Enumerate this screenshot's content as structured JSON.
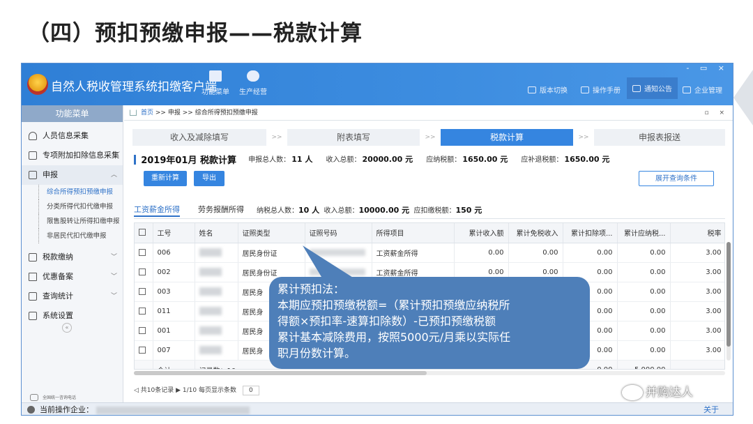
{
  "slide": {
    "title": "（四）预扣预缴申报——税款计算"
  },
  "app": {
    "name": "自然人税收管理系统扣缴客户端",
    "tools": [
      {
        "label": "功能菜单",
        "icon": "menu-icon"
      },
      {
        "label": "生产经营",
        "icon": "database-icon"
      }
    ],
    "right_tools": [
      {
        "label": "版本切换",
        "icon": "version-icon"
      },
      {
        "label": "操作手册",
        "icon": "manual-icon"
      },
      {
        "label": "通知公告",
        "icon": "mail-icon"
      },
      {
        "label": "企业管理",
        "icon": "building-icon"
      }
    ],
    "window_controls": "- ▭ ×"
  },
  "sidebar": {
    "header": "功能菜单",
    "items": [
      {
        "label": "人员信息采集",
        "icon": "person-icon"
      },
      {
        "label": "专项附加扣除信息采集",
        "icon": "list-icon",
        "chevron": "﹀"
      },
      {
        "label": "申报",
        "icon": "grid-icon",
        "chevron": "︿"
      }
    ],
    "subitems": [
      {
        "label": "综合所得预扣预缴申报"
      },
      {
        "label": "分类所得代扣代缴申报"
      },
      {
        "label": "限售股转让所得扣缴申报"
      },
      {
        "label": "非居民代扣代缴申报"
      }
    ],
    "items2": [
      {
        "label": "税款缴纳",
        "icon": "grid-icon",
        "chevron": "﹀"
      },
      {
        "label": "优惠备案",
        "icon": "doc-icon",
        "chevron": "﹀"
      },
      {
        "label": "查询统计",
        "icon": "grid-icon",
        "chevron": "﹀"
      },
      {
        "label": "系统设置",
        "icon": "grid-icon",
        "chevron": ""
      }
    ],
    "collapse": "«",
    "hotline_label": "全国统一咨询电话",
    "hotline_1": "12366",
    "hotline_2": "4001007815"
  },
  "status": {
    "label": "当前操作企业：",
    "link": "关于"
  },
  "breadcrumb": {
    "home": "首页",
    "sep": ">>",
    "level1": "申报",
    "level2": "综合所得预扣预缴申报",
    "controls": "▫ ×"
  },
  "steps": [
    {
      "label": "收入及减除填写"
    },
    {
      "label": "附表填写"
    },
    {
      "label": "税款计算"
    },
    {
      "label": "申报表报送"
    }
  ],
  "step_sep": ">>",
  "summary": {
    "period": "2019年01月  税款计算",
    "people_label": "申报总人数：",
    "people_value": "11 人",
    "income_label": "收入总额：",
    "income_value": "20000.00 元",
    "tax_label": "应纳税额：",
    "tax_value": "1650.00 元",
    "refund_label": "应补退税额：",
    "refund_value": "1650.00 元"
  },
  "buttons": {
    "recalc": "重新计算",
    "export": "导出",
    "expand": "展开查询条件"
  },
  "subtabs": {
    "tab1": "工资薪金所得",
    "tab2": "劳务报酬所得",
    "people_label": "纳税总人数：",
    "people_value": "10 人",
    "income_label": "收入总额：",
    "income_value": "10000.00 元",
    "withhold_label": "应扣缴税额：",
    "withhold_value": "150 元"
  },
  "table": {
    "headers": [
      "工号",
      "姓名",
      "证照类型",
      "证照号码",
      "所得项目",
      "累计收入额",
      "累计免税收入",
      "累计扣除项...",
      "累计应纳税...",
      "税率"
    ],
    "rows": [
      {
        "id": "006",
        "idtype": "居民身份证",
        "item": "工资薪金所得",
        "c1": "0.00",
        "c2": "0.00",
        "c3": "0.00",
        "c4": "0.00",
        "rate": "3.00"
      },
      {
        "id": "002",
        "idtype": "居民身份证",
        "item": "工资薪金所得",
        "c1": "0.00",
        "c2": "0.00",
        "c3": "0.00",
        "c4": "0.00",
        "rate": "3.00"
      },
      {
        "id": "003",
        "idtype": "居民身",
        "item": "",
        "c1": "",
        "c2": "",
        "c3": "0.00",
        "c4": "0.00",
        "rate": "3.00"
      },
      {
        "id": "011",
        "idtype": "居民身",
        "item": "",
        "c1": "",
        "c2": "",
        "c3": "0.00",
        "c4": "0.00",
        "rate": "3.00"
      },
      {
        "id": "001",
        "idtype": "居民身",
        "item": "",
        "c1": "",
        "c2": "",
        "c3": "0.00",
        "c4": "0.00",
        "rate": "3.00"
      },
      {
        "id": "007",
        "idtype": "居民身",
        "item": "",
        "c1": "",
        "c2": "",
        "c3": "0.00",
        "c4": "0.00",
        "rate": "3.00"
      }
    ],
    "total": {
      "dash": "--",
      "label": "合计",
      "count": "记录数：10",
      "dash2": "--",
      "c3": "0.00",
      "c4": "5,000.00",
      "rate": "--"
    }
  },
  "pager": {
    "text": "◁ 共10条记录 ▶ 1/10  每页显示条数",
    "size": "0"
  },
  "callout": {
    "line1": "累计预扣法：",
    "line2": "本期应预扣预缴税额=（累计预扣预缴应纳税所",
    "line3": "得额×预扣率-速算扣除数）-已预扣预缴税额",
    "line4": "累计基本减除费用，按照5000元/月乘以实际任",
    "line5": "职月份数计算。"
  },
  "watermark": "并购达人",
  "colors": {
    "brand_blue": "#3585e0",
    "header_blue": "#2f7fd6",
    "callout": "#4e7fb9"
  }
}
